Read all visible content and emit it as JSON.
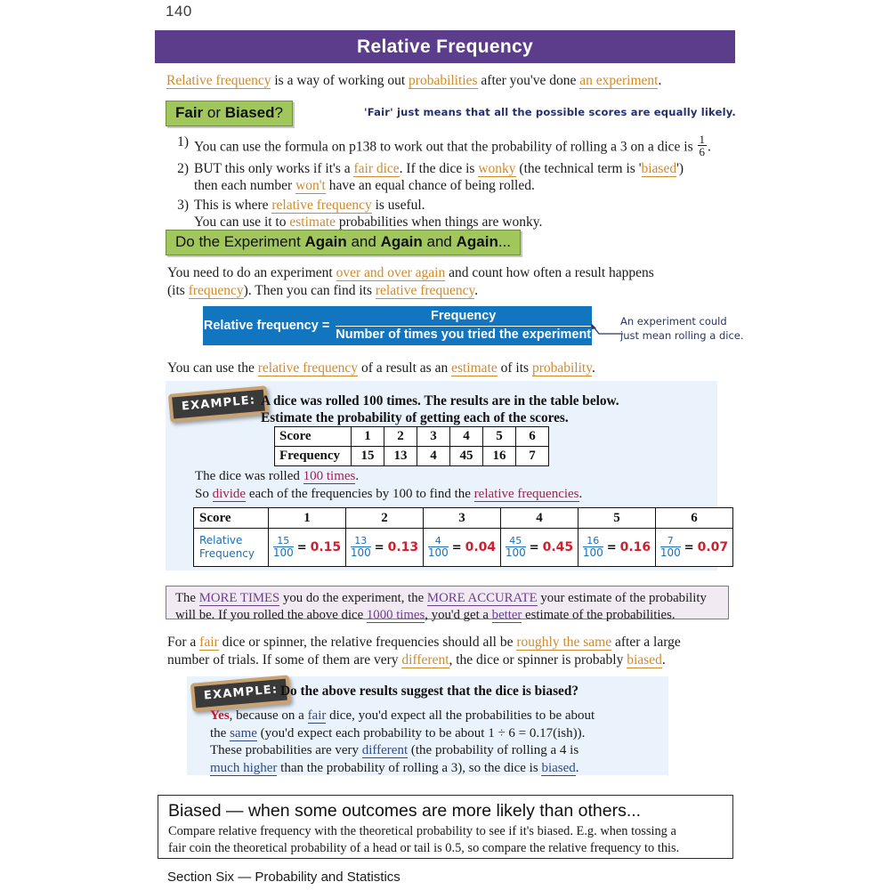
{
  "page": {
    "number": "140",
    "footer": "Section Six — Probability and Statistics"
  },
  "header": {
    "title": "Relative Frequency",
    "bar_color": "#5b3d8c"
  },
  "intro": {
    "part1": "Relative frequency",
    "part2": " is a way of working out ",
    "part3": "probabilities",
    "part4": " after you've done ",
    "part5": "an experiment",
    "part6": "."
  },
  "section_fair": {
    "heading_a": "Fair",
    "heading_b": " or ",
    "heading_c": "Biased",
    "heading_d": "?",
    "note": "'Fair' just means that all the possible scores are equally likely.",
    "items": [
      {
        "number": "1)",
        "text_before": "You can use the formula on p138 to work out that the probability of rolling a 3 on a dice is ",
        "fraction_num": "1",
        "fraction_den": "6",
        "text_after": "."
      },
      {
        "number": "2)",
        "seg1": "BUT this only works if it's a ",
        "hl1": "fair dice",
        "seg2": ".  If the dice is ",
        "hl2": "wonky",
        "seg3": " (the technical term is '",
        "hl3": "biased",
        "seg4": "')",
        "seg5": "then each number ",
        "hl4": "won't",
        "seg6": " have an equal chance of being rolled."
      },
      {
        "number": "3)",
        "seg1": "This is where ",
        "hl1": "relative frequency",
        "seg2": " is useful.",
        "seg3": "You can use it to ",
        "hl2": "estimate",
        "seg4": " probabilities when things are wonky."
      }
    ]
  },
  "section_again": {
    "heading_a": "Do the Experiment ",
    "heading_b": "Again",
    "heading_c": " and ",
    "heading_d": "Again",
    "heading_e": " and ",
    "heading_f": "Again",
    "heading_g": "...",
    "para": {
      "seg1": "You need to do an experiment ",
      "hl1": "over and over again",
      "seg2": " and count how often a result happens",
      "seg3": "(its ",
      "hl2": "frequency",
      "seg4": ").  Then you can find its ",
      "hl3": "relative frequency",
      "seg5": "."
    },
    "formula": {
      "lhs": "Relative frequency =",
      "numerator": "Frequency",
      "denominator": "Number of times you tried the experiment",
      "box_color": "#1175c0"
    },
    "annotation_line1": "An experiment could",
    "annotation_line2": "just mean rolling a dice.",
    "para_use": {
      "seg1": "You can use the ",
      "hl1": "relative frequency",
      "seg2": " of a result as an ",
      "hl2": "estimate",
      "seg3": " of its ",
      "hl3": "probability",
      "seg4": "."
    }
  },
  "example1": {
    "tag": "EXAMPLE:",
    "question_line1": "A dice was rolled 100 times.  The results are in the table below.",
    "question_line2": "Estimate the probability of getting each of the scores.",
    "freq_table": {
      "row_headers": [
        "Score",
        "Frequency"
      ],
      "scores": [
        "1",
        "2",
        "3",
        "4",
        "5",
        "6"
      ],
      "frequencies": [
        "15",
        "13",
        "4",
        "45",
        "16",
        "7"
      ]
    },
    "body": {
      "seg1": "The dice was rolled ",
      "hl1": "100 times",
      "seg2": ".",
      "seg3": "So ",
      "hl2": "divide",
      "seg4": " each of the frequencies by 100 to find the ",
      "hl3": "relative frequencies",
      "seg5": "."
    },
    "relfreq_table": {
      "score_header": "Score",
      "rf_header_line1": "Relative",
      "rf_header_line2": "Frequency",
      "scores": [
        "1",
        "2",
        "3",
        "4",
        "5",
        "6"
      ],
      "numerators": [
        "15",
        "13",
        "4",
        "45",
        "16",
        "7"
      ],
      "denominator": "100",
      "equals": "=",
      "results": [
        "0.15",
        "0.13",
        "0.04",
        "0.45",
        "0.16",
        "0.07"
      ],
      "fraction_color": "#1a6fb5",
      "result_color": "#d0202f"
    }
  },
  "pink_box": {
    "seg1": "The ",
    "hl1": "MORE TIMES",
    "seg2": " you do the experiment, the ",
    "hl2": "MORE ACCURATE",
    "seg3": " your estimate of the probability",
    "seg4": "will be.  If you rolled the above dice ",
    "hl3": "1000 times",
    "seg5": ", you'd get a ",
    "hl4": "better",
    "seg6": " estimate of the probabilities.",
    "background": "#f2eaf2"
  },
  "fair_dice_para": {
    "seg1": "For a ",
    "hl1": "fair",
    "seg2": " dice or spinner, the relative frequencies should all be ",
    "hl2": "roughly the same",
    "seg3": " after a large",
    "seg4": "number of trials.  If some of them are very ",
    "hl3": "different",
    "seg5": ", the dice or spinner is probably ",
    "hl4": "biased",
    "seg6": "."
  },
  "example2": {
    "tag": "EXAMPLE:",
    "question": "Do the above results suggest that the dice is biased?",
    "body": {
      "yes": "Yes",
      "seg1": ", because on a ",
      "hl1": "fair",
      "seg2": " dice, you'd expect all the probabilities to be about",
      "seg3": "the ",
      "hl2": "same",
      "seg4": " (you'd expect each probability to be about 1 ÷ 6 = 0.17(ish)).",
      "seg5": "These probabilities are very ",
      "hl3": "different",
      "seg6": " (the probability of rolling a 4 is",
      "hl4": "much higher",
      "seg7": " than the probability of rolling a 3), so the dice is ",
      "hl5": "biased",
      "seg8": "."
    }
  },
  "summary": {
    "title": "Biased — when some outcomes are more likely than others...",
    "line1": "Compare relative frequency with the theoretical probability to see if it's biased.  E.g. when tossing a",
    "line2": "fair coin the theoretical probability of a head or tail is 0.5, so compare the relative frequency to this."
  }
}
